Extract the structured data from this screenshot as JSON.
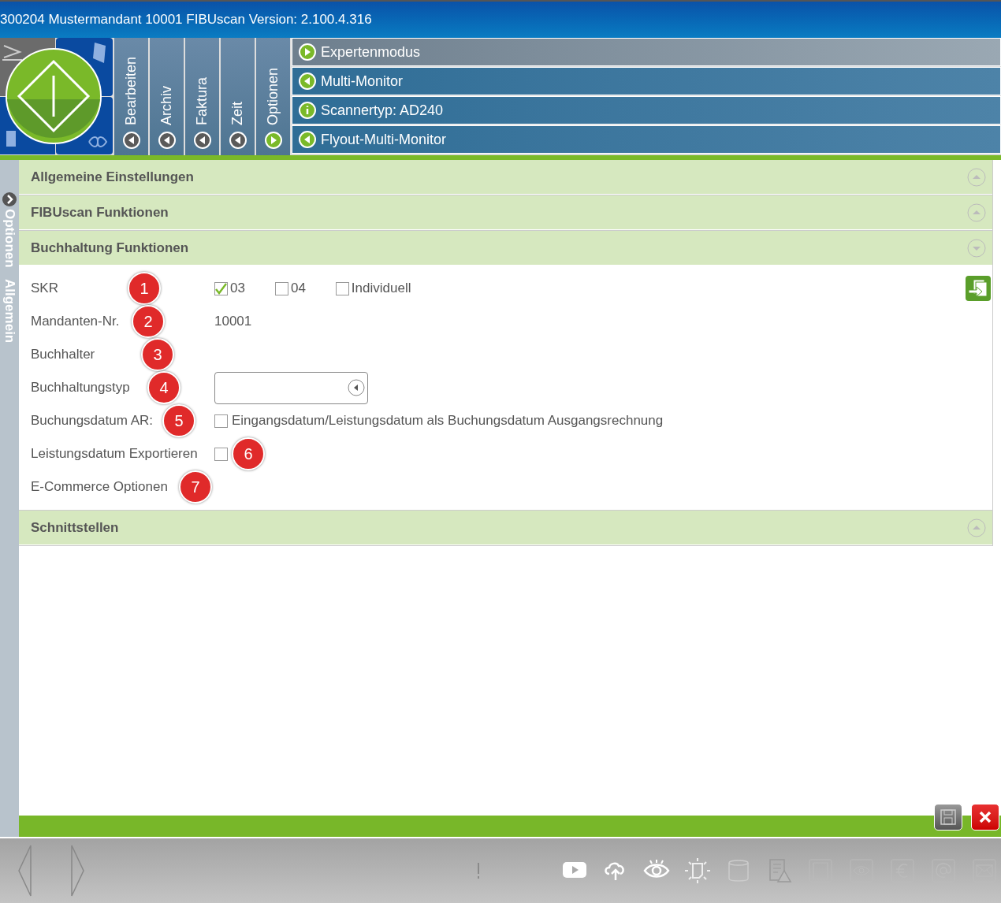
{
  "window": {
    "title": "300204 Mustermandant 10001 FIBUscan Version: 2.100.4.316"
  },
  "tabs": [
    {
      "label": "Bearbeiten",
      "selected": false
    },
    {
      "label": "Archiv",
      "selected": false
    },
    {
      "label": "Faktura",
      "selected": false
    },
    {
      "label": "Zeit",
      "selected": false
    },
    {
      "label": "Optionen",
      "selected": true
    }
  ],
  "flyout": [
    {
      "label": "Expertenmodus",
      "kind": "action",
      "selected": true
    },
    {
      "label": "Multi-Monitor",
      "kind": "action",
      "selected": false
    },
    {
      "label": "Scannertyp: AD240",
      "kind": "info",
      "selected": false
    },
    {
      "label": "Flyout-Multi-Monitor",
      "kind": "action",
      "selected": false
    }
  ],
  "sidebar": {
    "labels": [
      "Optionen",
      "Allgemein"
    ]
  },
  "sections": [
    {
      "title": "Allgemeine Einstellungen",
      "expanded": false
    },
    {
      "title": "FIBUscan Funktionen",
      "expanded": false
    },
    {
      "title": "Buchhaltung Funktionen",
      "expanded": true,
      "fields": [
        {
          "label": "SKR",
          "badge": "1",
          "kind": "options",
          "options": [
            {
              "label": "03",
              "checked": true
            },
            {
              "label": "04",
              "checked": false
            },
            {
              "label": "Individuell",
              "checked": false
            }
          ]
        },
        {
          "label": "Mandanten-Nr.",
          "badge": "2",
          "kind": "text",
          "value": "10001"
        },
        {
          "label": "Buchhalter",
          "badge": "3",
          "kind": "empty"
        },
        {
          "label": "Buchhaltungstyp",
          "badge": "4",
          "kind": "select"
        },
        {
          "label": "Buchungsdatum AR:",
          "badge": "5",
          "kind": "checkbox",
          "checked": false,
          "text": "Eingangsdatum/Leistungsdatum als Buchungsdatum Ausgangsrechnung"
        },
        {
          "label": "Leistungsdatum Exportieren",
          "badge": "6",
          "kind": "checkbox",
          "checked": false
        },
        {
          "label": "E-Commerce Optionen",
          "badge": "7",
          "kind": "empty"
        }
      ]
    },
    {
      "title": "Schnittstellen",
      "expanded": false
    }
  ]
}
